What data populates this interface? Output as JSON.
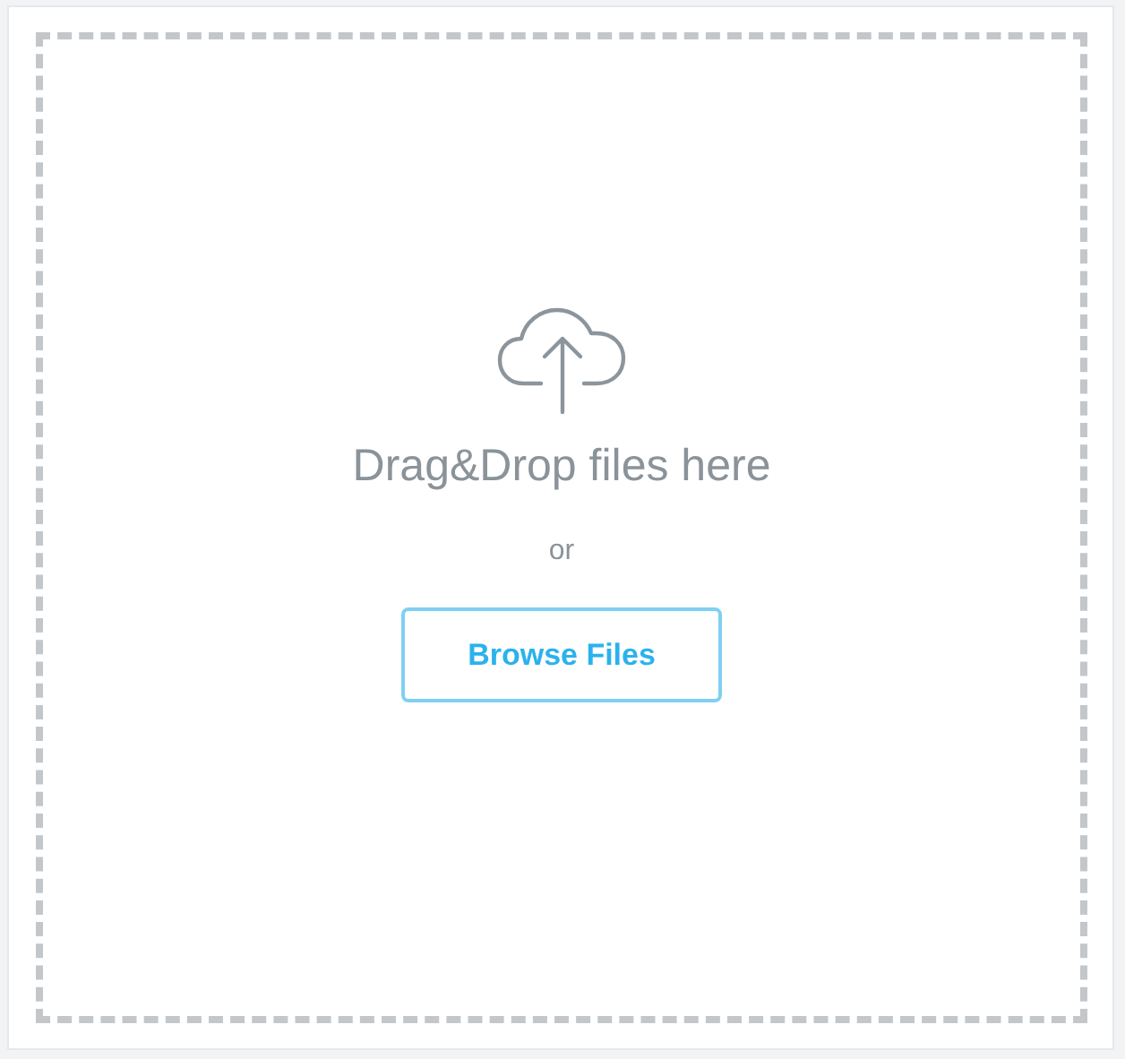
{
  "dropzone": {
    "prompt": "Drag&Drop files here",
    "separator": "or",
    "button": "Browse Files"
  }
}
